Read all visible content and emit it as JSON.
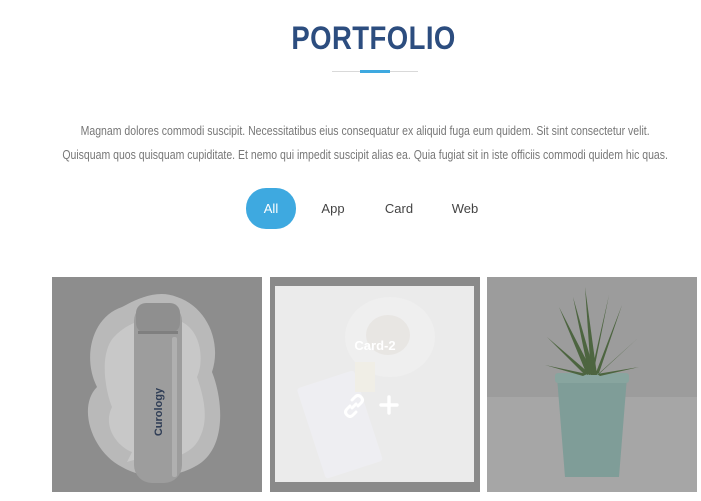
{
  "section": {
    "title": "PORTFOLIO",
    "description": "Magnam dolores commodi suscipit. Necessitatibus eius consequatur ex aliquid fuga eum quidem. Sit sint consectetur velit. Quisquam quos quisquam cupiditate. Et nemo qui impedit suscipit alias ea. Quia fugiat sit in iste officiis commodi quidem hic quas."
  },
  "filters": [
    {
      "label": "All",
      "active": true
    },
    {
      "label": "App",
      "active": false
    },
    {
      "label": "Card",
      "active": false
    },
    {
      "label": "Web",
      "active": false
    }
  ],
  "items": [
    {
      "image": "cosmetic-bottle-on-cream-splash",
      "brand_text": "Curology"
    },
    {
      "image": "coffee-cup-and-card-flatlay",
      "title": "Card-2",
      "icons": [
        "link-icon",
        "plus-icon"
      ]
    },
    {
      "image": "potted-aloe-plant"
    }
  ],
  "colors": {
    "title": "#2c4d7f",
    "accent": "#3ea9e0",
    "description": "#777777"
  }
}
